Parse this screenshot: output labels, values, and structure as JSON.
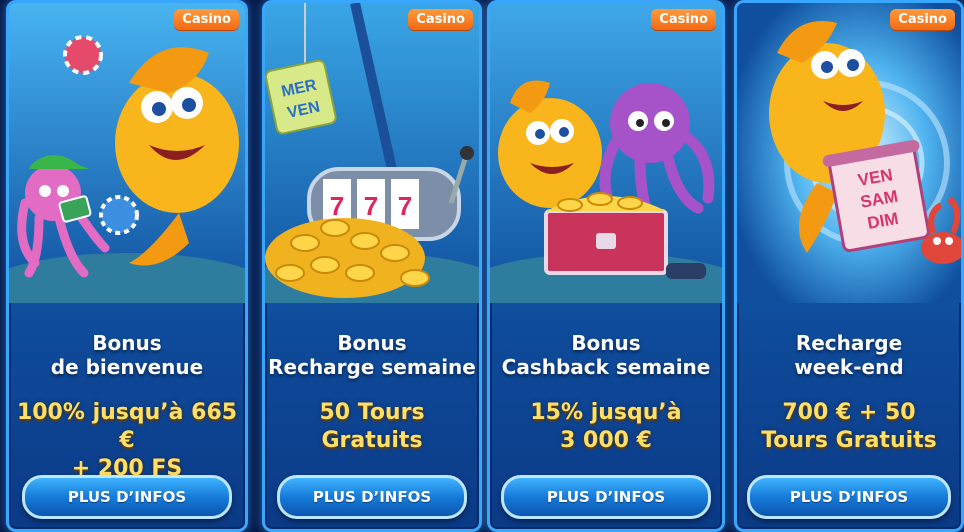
{
  "cards": [
    {
      "badge": "Casino",
      "title": [
        "Bonus",
        "de bienvenue"
      ],
      "offer": [
        "100% jusqu’à 665 €",
        "+ 200 FS"
      ],
      "button": "PLUS D’INFOS",
      "art": "goldfish-octopus-poker-chips-illustration"
    },
    {
      "badge": "Casino",
      "title": [
        "Bonus",
        "Recharge semaine"
      ],
      "offer": [
        "50 Tours",
        "Gratuits"
      ],
      "button": "PLUS D’INFOS",
      "art": "slot-machine-gold-coins-illustration",
      "tag_lines": [
        "MER",
        "VEN"
      ]
    },
    {
      "badge": "Casino",
      "title": [
        "Bonus",
        "Cashback semaine"
      ],
      "offer": [
        "15% jusqu’à",
        "3 000 €"
      ],
      "button": "PLUS D’INFOS",
      "art": "goldfish-octopus-treasure-chest-illustration"
    },
    {
      "badge": "Casino",
      "title": [
        "Recharge",
        "week-end"
      ],
      "offer": [
        "700 € + 50",
        "Tours Gratuits"
      ],
      "button": "PLUS D’INFOS",
      "art": "goldfish-whirlpool-scroll-illustration",
      "scroll_lines": [
        "VEN",
        "SAM",
        "DIM"
      ]
    }
  ]
}
